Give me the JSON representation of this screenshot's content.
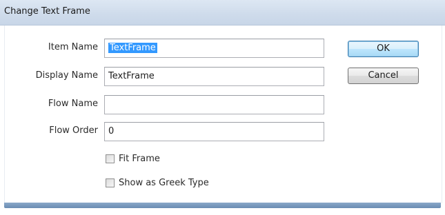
{
  "window": {
    "title": "Change Text Frame"
  },
  "form": {
    "item_name": {
      "label": "Item Name",
      "value": "TextFrame",
      "selected": true
    },
    "display_name": {
      "label": "Display Name",
      "value": "TextFrame"
    },
    "flow_name": {
      "label": "Flow Name",
      "value": ""
    },
    "flow_order": {
      "label": "Flow Order",
      "value": "0"
    },
    "fit_frame": {
      "label": "Fit Frame",
      "checked": false
    },
    "show_greek": {
      "label": "Show as Greek Type",
      "checked": false
    }
  },
  "buttons": {
    "ok": "OK",
    "cancel": "Cancel"
  }
}
